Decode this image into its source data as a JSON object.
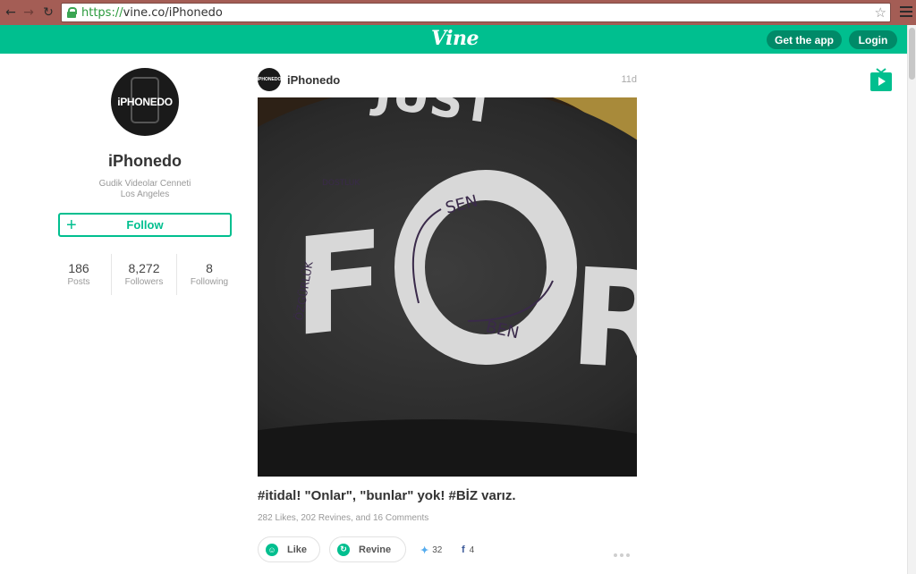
{
  "browser": {
    "url_scheme": "https://",
    "url_rest": "vine.co/iPhonedo"
  },
  "header": {
    "logo": "Vine",
    "get_app_label": "Get the app",
    "login_label": "Login",
    "brand_color": "#00bf8f"
  },
  "profile": {
    "avatar_text": "iPHONEDO",
    "name": "iPhonedo",
    "description": "Gudik Videolar Cenneti",
    "location": "Los Angeles",
    "follow_label": "Follow",
    "stats": [
      {
        "value": "186",
        "label": "Posts"
      },
      {
        "value": "8,272",
        "label": "Followers"
      },
      {
        "value": "8",
        "label": "Following"
      }
    ]
  },
  "post": {
    "avatar_text": "iPHONEDO",
    "username": "iPhonedo",
    "time": "11d",
    "caption": "#itidal! \"Onlar\", \"bunlar\" yok! #BİZ varız.",
    "stats_line": "282 Likes, 202 Revines, and 16 Comments",
    "like_label": "Like",
    "revine_label": "Revine",
    "twitter_count": "32",
    "facebook_count": "4",
    "video_texts": {
      "big_left": "F",
      "big_mid": "O",
      "big_right": "R",
      "top_word": "JUST",
      "arrow_sen": "SEN",
      "arrow_ben": "BEN",
      "side_word": "ÖZGÜRLÜK",
      "small_word": "DOSTLUK"
    }
  }
}
